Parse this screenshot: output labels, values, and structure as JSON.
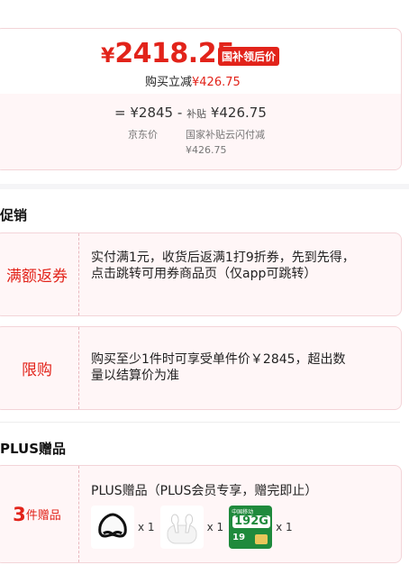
{
  "price_card": {
    "currency": "¥",
    "final_price": "2418.25",
    "badge": "国补领后价",
    "reduce_prefix": "购买立减",
    "reduce_amount": "¥426.75",
    "calc_equals": "=",
    "calc_jd_price": "¥2845",
    "calc_minus": "-",
    "calc_subsidy_label": "补贴",
    "calc_subsidy_amount": "¥426.75",
    "jd_price_label": "京东价",
    "subsidy_label": "国家补贴云闪付减",
    "subsidy_amount": "¥426.75"
  },
  "promo_section": {
    "title": "促销",
    "items": [
      {
        "label": "满额返券",
        "desc": "实付满1元，收货后返满1打9折券，先到先得，点击跳转可用券商品页（仅app可跳转）"
      },
      {
        "label": "限购",
        "desc": "购买至少1件时可享受单件价￥2845，超出数量以结算价为准"
      }
    ]
  },
  "plus_section": {
    "title": "PLUS赠品",
    "count": "3",
    "count_suffix": "件赠品",
    "gift_title": "PLUS赠品（PLUS会员专享，赠完即止）",
    "gifts": [
      {
        "icon": "sleep-mask-icon",
        "qty": "x 1"
      },
      {
        "icon": "earbuds-icon",
        "qty": "x 1"
      },
      {
        "icon": "sim-card-icon",
        "qty": "x 1",
        "card_text": "192G",
        "card_brand": "中国移动",
        "card_price": "19"
      }
    ]
  }
}
